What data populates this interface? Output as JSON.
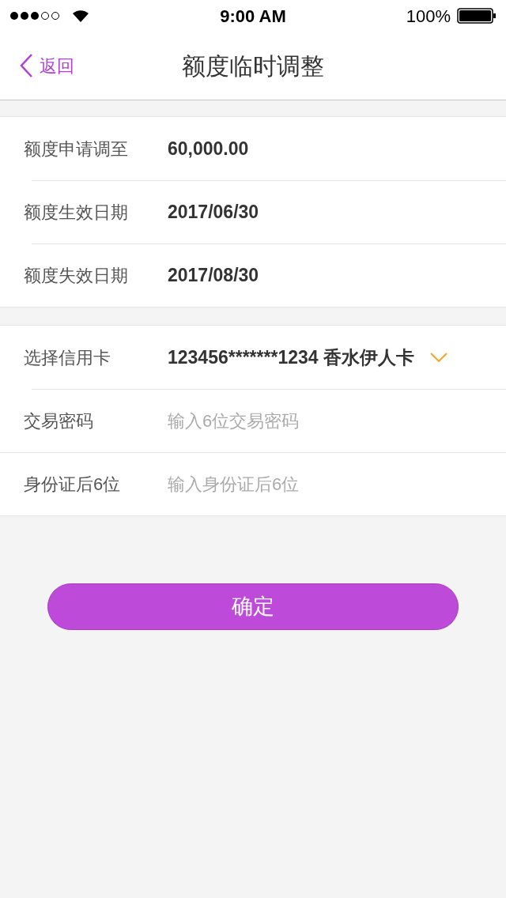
{
  "status_bar": {
    "time": "9:00 AM",
    "battery": "100%"
  },
  "nav": {
    "back": "返回",
    "title": "额度临时调整"
  },
  "sections": [
    {
      "rows": [
        {
          "kind": "value",
          "label": "额度申请调至",
          "value": "60,000.00"
        },
        {
          "kind": "value",
          "label": "额度生效日期",
          "value": "2017/06/30"
        },
        {
          "kind": "value",
          "label": "额度失效日期",
          "value": "2017/08/30"
        }
      ]
    },
    {
      "rows": [
        {
          "kind": "select",
          "label": "选择信用卡",
          "value": "123456*******1234 香水伊人卡"
        },
        {
          "kind": "input",
          "label": "交易密码",
          "placeholder": "输入6位交易密码"
        },
        {
          "kind": "input",
          "label": "身份证后6位",
          "placeholder": "输入身份证后6位"
        }
      ]
    }
  ],
  "confirm_button": "确定"
}
